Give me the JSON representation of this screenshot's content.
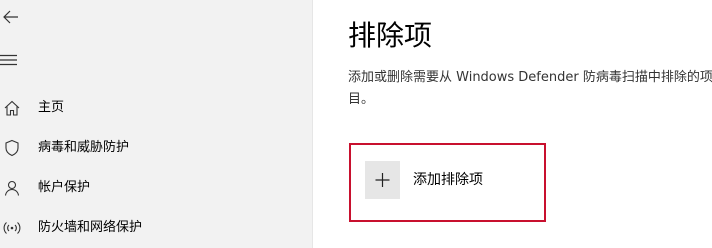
{
  "sidebar": {
    "back_icon": "back-arrow-icon",
    "menu_icon": "hamburger-icon",
    "items": [
      {
        "label": "主页",
        "icon": "home-icon"
      },
      {
        "label": "病毒和威胁防护",
        "icon": "shield-icon"
      },
      {
        "label": "帐户保护",
        "icon": "person-icon"
      },
      {
        "label": "防火墙和网络保护",
        "icon": "wifi-icon"
      }
    ]
  },
  "main": {
    "title": "排除项",
    "description": "添加或删除需要从 Windows Defender 防病毒扫描中排除的项目。",
    "add_button": {
      "label": "添加排除项",
      "icon": "plus-icon"
    }
  },
  "colors": {
    "sidebar_bg": "#f2f2f2",
    "highlight_border": "#c8102e",
    "button_tile": "#e6e6e6"
  }
}
